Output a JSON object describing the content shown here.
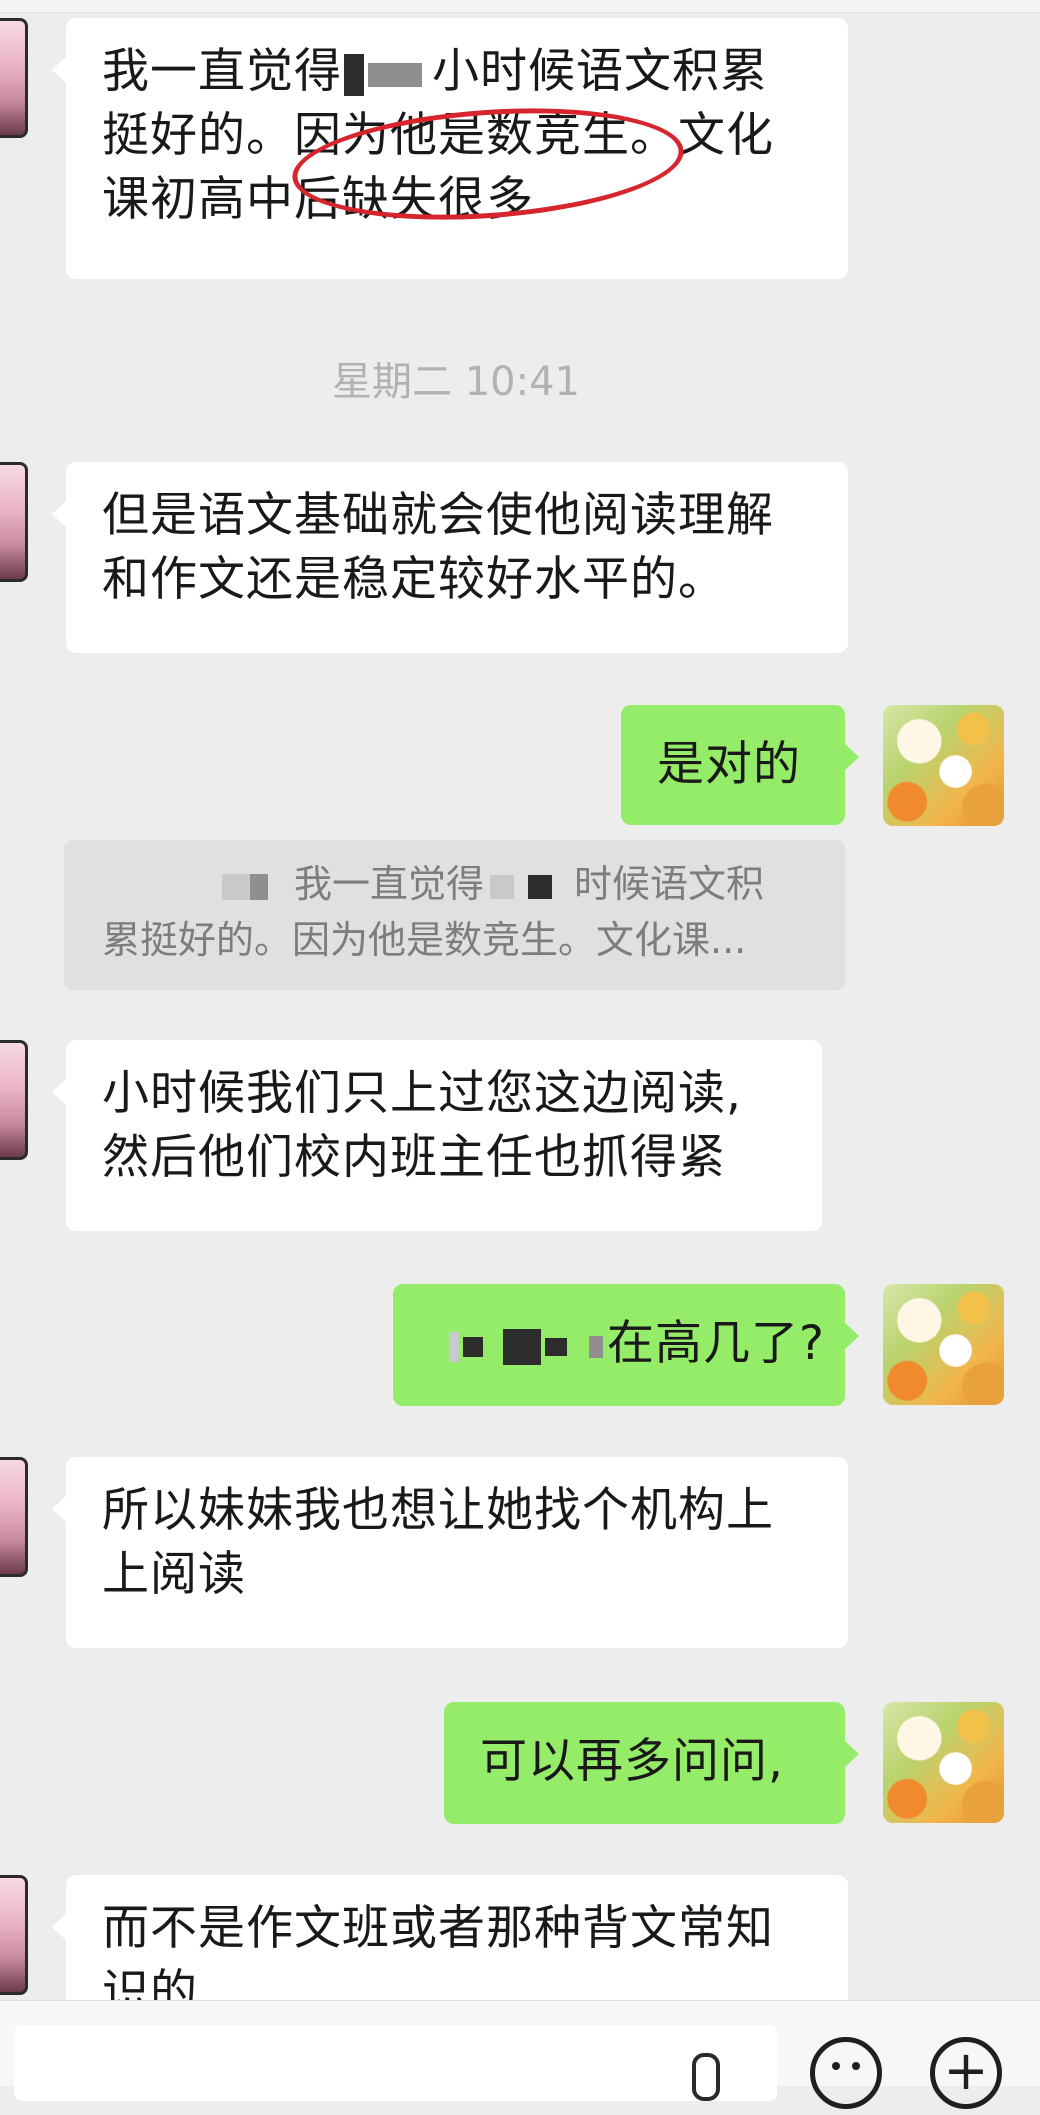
{
  "messages": [
    {
      "side": "left",
      "line1_a": "我一直觉得",
      "line1_b": "小时候语文积累",
      "line2_a": "挺好的。",
      "line2_b": "因为他是数竞生",
      "line2_c": "。文化",
      "line3": "课初高中后缺失很多"
    },
    {
      "side": "left",
      "line1": "但是语文基础就会使他阅读理解",
      "line2": "和作文还是稳定较好水平的。"
    },
    {
      "side": "right",
      "text": "是对的"
    },
    {
      "side": "left",
      "line1": "小时候我们只上过您这边阅读,",
      "line2": "然后他们校内班主任也抓得紧"
    },
    {
      "side": "right",
      "text": "在高几了?"
    },
    {
      "side": "left",
      "line1": "所以妹妹我也想让她找个机构上",
      "line2": "上阅读"
    },
    {
      "side": "right",
      "text": "可以再多问问,"
    },
    {
      "side": "left",
      "line1": "而不是作文班或者那种背文常知",
      "line2": "识的"
    }
  ],
  "timestamp": "星期二 10:41",
  "quote": {
    "line1_a": "我一直觉得",
    "line1_b": "时候语文积",
    "line2": "累挺好的。因为他是数竞生。文化课..."
  },
  "input_bar": {
    "emoji_icon": "smiley-icon",
    "plus_icon": "plus-icon",
    "plus": "+"
  },
  "colors": {
    "background": "#ededed",
    "received_bubble": "#ffffff",
    "sent_bubble": "#95ec69",
    "annotation": "#d6252c"
  }
}
